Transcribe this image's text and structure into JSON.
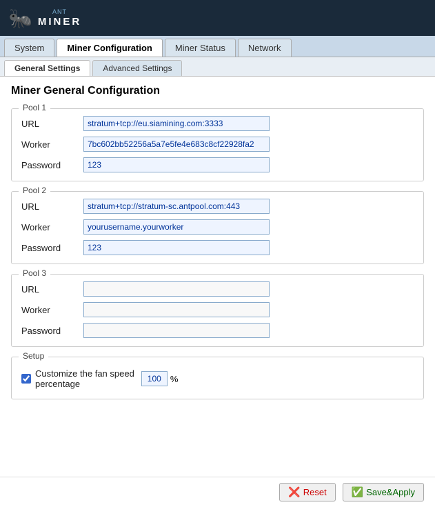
{
  "header": {
    "ant_label": "ANT",
    "miner_label": "MINER"
  },
  "main_tabs": [
    {
      "id": "system",
      "label": "System",
      "active": false
    },
    {
      "id": "miner-configuration",
      "label": "Miner Configuration",
      "active": true
    },
    {
      "id": "miner-status",
      "label": "Miner Status",
      "active": false
    },
    {
      "id": "network",
      "label": "Network",
      "active": false
    }
  ],
  "sub_tabs": [
    {
      "id": "general-settings",
      "label": "General Settings",
      "active": true
    },
    {
      "id": "advanced-settings",
      "label": "Advanced Settings",
      "active": false
    }
  ],
  "page_title": "Miner General Configuration",
  "pools": [
    {
      "label": "Pool 1",
      "url": "stratum+tcp://eu.siamining.com:3333",
      "worker": "7bc602bb52256a5a7e5fe4e683c8cf22928fa2",
      "password": "123"
    },
    {
      "label": "Pool 2",
      "url": "stratum+tcp://stratum-sc.antpool.com:443",
      "worker": "yourusername.yourworker",
      "password": "123"
    },
    {
      "label": "Pool 3",
      "url": "",
      "worker": "",
      "password": ""
    }
  ],
  "setup": {
    "legend": "Setup",
    "fan_label": "Customize the fan speed\npercentage",
    "fan_value": "100",
    "fan_percent": "%",
    "fan_checked": true
  },
  "footer": {
    "reset_label": "Reset",
    "apply_label": "Save&Apply"
  }
}
